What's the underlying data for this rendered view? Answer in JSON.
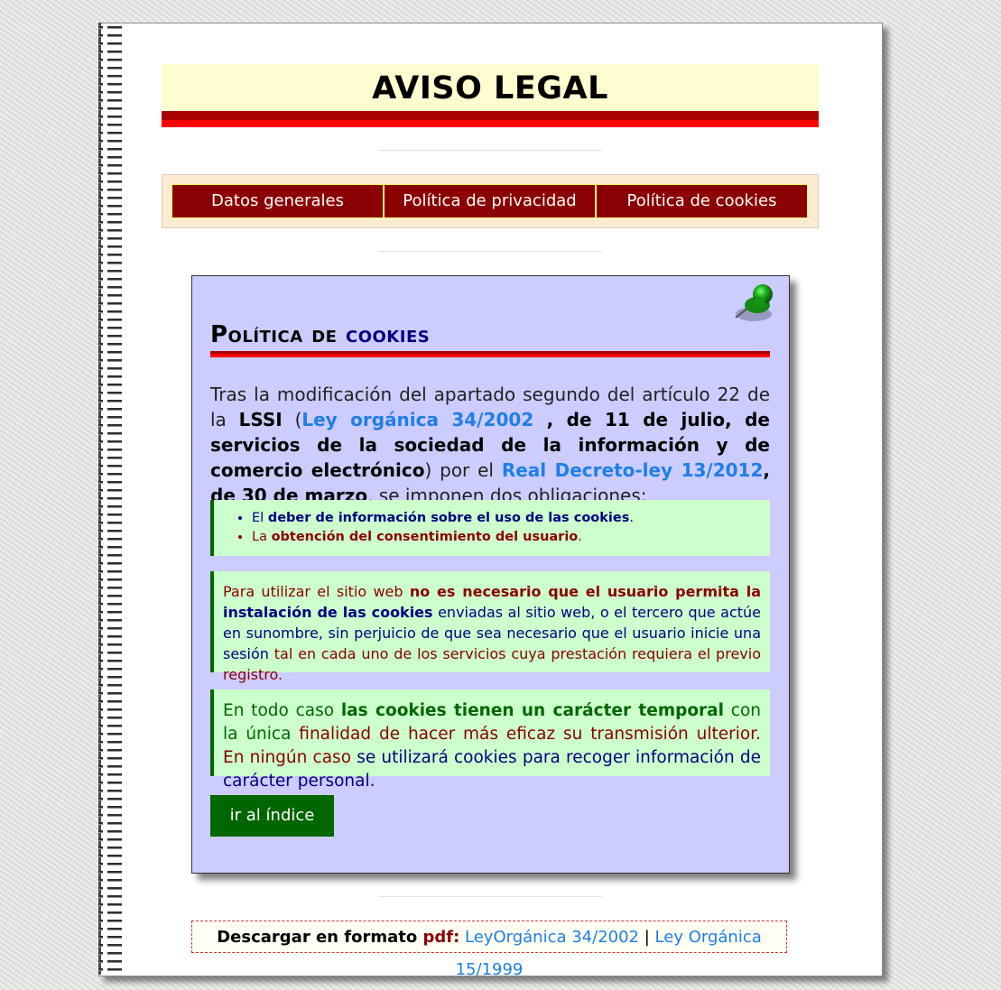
{
  "page": {
    "title": "AVISO LEGAL"
  },
  "nav": {
    "items": [
      {
        "label": "Datos generales"
      },
      {
        "label": "Política de privacidad"
      },
      {
        "label": "Política de cookies"
      }
    ]
  },
  "card": {
    "title_part1": "Política de ",
    "title_part2": "cookies",
    "intro": {
      "t1": "Tras la modificación del apartado segundo del artículo 22 de la ",
      "lssi": "LSSI",
      "t2": " (",
      "link1": "Ley orgánica 34/2002",
      "b1": " , de 11 de julio, de servicios de la sociedad de la información y de comercio electrónico",
      "t3": ") por el ",
      "link2": "Real Decreto-ley 13/2012",
      "b2": ", de 30 de marzo",
      "t4": ", se imponen dos obligaciones:"
    },
    "list": [
      {
        "pre": "El ",
        "bold": "deber de información sobre el uso de las cookies",
        "post": "."
      },
      {
        "pre": "La ",
        "bold": "obtención del consentimiento del usuario",
        "post": "."
      }
    ],
    "box2": {
      "t1": "Para utilizar el sitio web ",
      "b1": "no es necesario que el usuario permita la",
      "b2": "instalación de las cookies",
      "t2": " enviadas al sitio web, o el tercero que actúe en sunombre, sin perjuicio de que sea necesario que el usuario inicie una sesión",
      "t3": "tal en cada uno de los servicios cuya prestación requiera el previo registro."
    },
    "box3": {
      "t1": "En todo caso ",
      "b1": "las cookies tienen un carácter temporal",
      "t2": " con la única",
      "t3": "finalidad de hacer más eficaz su transmisión ulterior. En ningún caso",
      "t4": "se utilizará cookies para recoger información de carácter personal."
    },
    "button": "ir al índice"
  },
  "download": {
    "label": "Descargar en formato ",
    "pdf": "pdf:",
    "link1": "LeyOrgánica 34/2002",
    "sep": "|",
    "link2": "Ley Orgánica 15/1999"
  },
  "colors": {
    "nav_bg": "#8b0000",
    "card_bg": "#ccccff",
    "box_bg": "#ccffcc",
    "accent_red": "#ff0000",
    "link_blue": "#1e7ee8",
    "button_green": "#006600"
  }
}
